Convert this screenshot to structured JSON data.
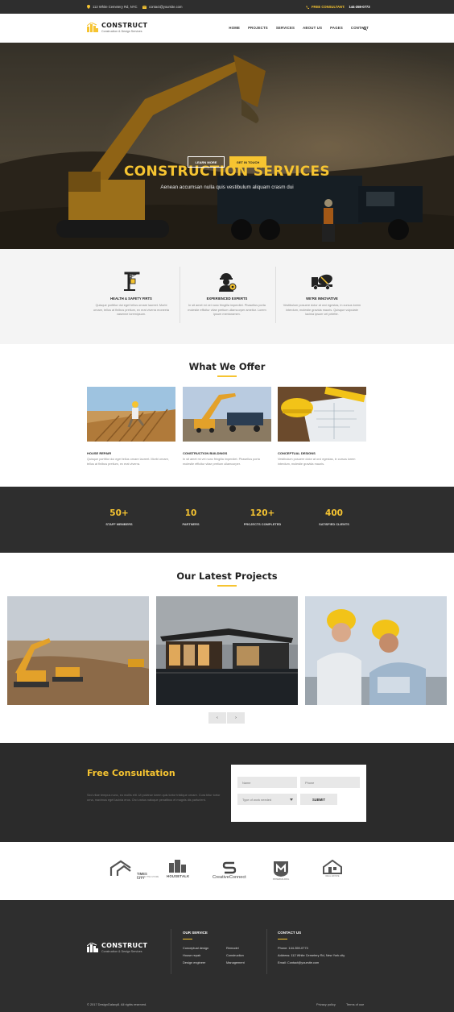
{
  "topbar": {
    "address": "112 White Cemetery Rd, NYC",
    "email": "contact@yoursite.com",
    "consult_label": "FREE CONSULTANT:",
    "phone": "144-359-0773"
  },
  "brand": {
    "name": "CONSTRUCT",
    "tagline": "Construction & Design Services"
  },
  "nav": [
    "HOME",
    "PROJECTS",
    "SERVICES",
    "ABOUT US",
    "PAGES",
    "CONTACT"
  ],
  "hero": {
    "title": "CONSTRUCTION SERVICES",
    "subtitle": "Aenean accumsan nulla quis vestibulum aliquam crasm dui",
    "btn_learn": "LEARN MORE",
    "btn_touch": "GET IN TOUCH"
  },
  "features": [
    {
      "icon": "crane-icon",
      "title": "HEALTH & SAFETY FIRTS",
      "text": "Quisque porttitor dui eget tellus ornare laoreet. Morbi ornare, tellus at finibus pretium, ex erat viverra moneeta vasenne loremipsum."
    },
    {
      "icon": "engineer-icon",
      "title": "EXPERIENCED EXPERTS",
      "text": "In sit amet mi vei nunc fringilla imperdiet. Phasellus porta molestie efficitur vitae pretium ullamcorper ameitur. Lorem ipsum mentoramen."
    },
    {
      "icon": "mixer-truck-icon",
      "title": "WE'RE INNOVATIVE",
      "text": "Vestibulum posuere dolor at orci egestas, in cursus lorem interdum, molestie gravida mauris. Quisque vulputate lacinia ipsum vel pelette."
    }
  ],
  "offer": {
    "title": "What We Offer",
    "items": [
      {
        "title": "HOUSE REPAIR",
        "text": "Quisque porttitor dui eget tellus ornare laoreet. Morbi ornare, tellus at finibus pretium, ex erat viverra."
      },
      {
        "title": "CONSTRUCTION BUILDINGS",
        "text": "In sit amet mi vei nunc fringilla imperdiet. Phasellus porta molestie efficitur vitae pretium ullamcorper."
      },
      {
        "title": "CONCEPTUAL DESIGNS",
        "text": "Vestibulum posuere dolor at orci egestas, in cursus lorem interdum, molestie gravida mauris."
      }
    ]
  },
  "stats": [
    {
      "num": "50+",
      "label": "STAFF MEMBERS"
    },
    {
      "num": "10",
      "label": "PARTNERS"
    },
    {
      "num": "120+",
      "label": "PROJECTS COMPLETED"
    },
    {
      "num": "400",
      "label": "SATISFIED CLIENTS"
    }
  ],
  "projects": {
    "title": "Our Latest Projects",
    "prev": "‹",
    "next": "›"
  },
  "consult": {
    "title": "Free Consultation",
    "text": "Sed vitae tempus nunc, eu mollis elit. Ut pulvinar lorem quis tortor tristique ornare. Cura bitur tortor urna, maximus eget lacinia eros. Orci varius natoque penatibus et magnis dis parturient.",
    "name_ph": "Name",
    "phone_ph": "Phone",
    "work_ph": "Type of work needed",
    "submit": "SUBMIT"
  },
  "partners": [
    {
      "name": "TIMES CITY",
      "sub": "BUILDING THE FUTURE",
      "icon": "roof-icon"
    },
    {
      "name": "HOUSETALK",
      "sub": "",
      "icon": "buildings-icon"
    },
    {
      "name": "CreativeConnect",
      "sub": "",
      "icon": "s-shape-icon"
    },
    {
      "name": "",
      "sub": "PRIMEBUILDING",
      "icon": "m-shield-icon"
    },
    {
      "name": "",
      "sub": "REAL ESTATE",
      "icon": "house-outline-icon"
    }
  ],
  "footer": {
    "service_title": "OUR SERVICE",
    "services_col1": [
      "Conceptual design",
      "House repair",
      "Design engineer"
    ],
    "services_col2": [
      "Remodel",
      "Construction",
      "Management"
    ],
    "contact_title": "CONTACT US",
    "contact": [
      "Phone: 144-359-0773",
      "Address: 112 White Cemetery Rd, New York city",
      "Email: Contact@yoursite.com"
    ],
    "copyright": "© 2017 DesignGalaxy8. All rights reserved.",
    "privacy": "Privacy policy",
    "terms": "Terms of use"
  },
  "colors": {
    "accent": "#f6c431",
    "dark": "#2e2e2e"
  }
}
